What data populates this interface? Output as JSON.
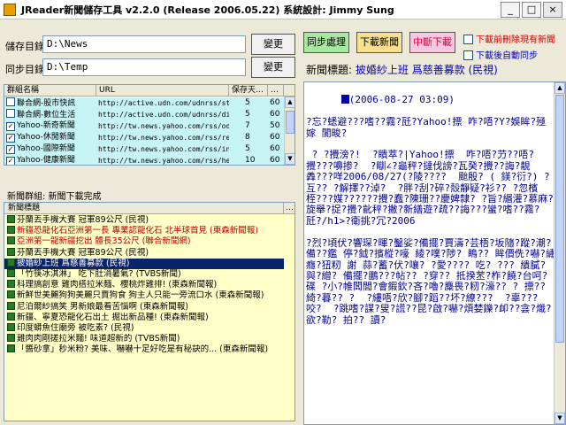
{
  "window": {
    "title": "JReader新聞儲存工具 v2.2.0 (Release 2006.05.22)  系統設計: Jimmy Sung",
    "min_label": "_",
    "max_label": "□",
    "close_label": "×"
  },
  "paths": {
    "store_label": "儲存目錄:",
    "store_value": "D:\\News",
    "store_change": "變更",
    "sync_label": "同步目錄:",
    "sync_value": "D:\\Temp",
    "sync_change": "變更"
  },
  "toolbar": {
    "sync_btn": "同步處理",
    "download_btn": "下載新聞",
    "stop_btn": "中斷下載",
    "opt_delete": "下載前刪除現有新聞",
    "opt_autosync": "下載後自動同步"
  },
  "feeds": {
    "headers": [
      "群組名稱",
      "URL",
      "保存天…",
      "…"
    ],
    "rows": [
      {
        "checked": false,
        "name": "聯合網-股市快訊",
        "url": "http://active.udn.com/udnrss/stklatest…",
        "days": "5",
        "n": "60"
      },
      {
        "checked": false,
        "name": "聯合網-數位生活",
        "url": "http://active.udn.com/udnrss/digilife.x…",
        "days": "5",
        "n": "60"
      },
      {
        "checked": true,
        "name": "Yahoo-新奇新聞",
        "url": "http://tw.news.yahoo.com/rss/oddlyen…",
        "days": "7",
        "n": "50"
      },
      {
        "checked": true,
        "name": "Yahoo-休閒新聞",
        "url": "http://tw.news.yahoo.com/rss/relaxation",
        "days": "8",
        "n": "60"
      },
      {
        "checked": true,
        "name": "Yahoo-國際新聞",
        "url": "http://tw.news.yahoo.com/rss/internati…",
        "days": "5",
        "n": "60"
      },
      {
        "checked": true,
        "name": "Yahoo-健康新聞",
        "url": "http://tw.news.yahoo.com/rss/health",
        "days": "10",
        "n": "60"
      }
    ]
  },
  "status": {
    "text": "新聞群組: 新聞下載完成"
  },
  "news_list": {
    "header": "新聞標題",
    "header2": "…",
    "items": [
      {
        "text": "芬蘭丟手機大賽 冠軍89公尺 (民視)",
        "red": false,
        "sel": false
      },
      {
        "text": "新疆恐龍化石亞洲第一長 專業認龍化石 北半球首見 (東森新聞報)",
        "red": true,
        "sel": false
      },
      {
        "text": "亞洲第一龍新疆挖出 體長35公尺 (聯合新聞網)",
        "red": true,
        "sel": false
      },
      {
        "text": "芬蘭丟手機大賽 冠軍89公尺 (民視)",
        "red": false,
        "sel": false
      },
      {
        "text": "披婚紗上班 爲慈善募款 (民視)",
        "red": false,
        "sel": true
      },
      {
        "text": "「竹筷冰淇淋」 吃下肚消暑氣? (TVBS新聞)",
        "red": false,
        "sel": false
      },
      {
        "text": "科理搞創意 雞肉搭拉米麵、櫻桃炸雞排! (東森新聞報)",
        "red": false,
        "sel": false
      },
      {
        "text": "新鮮世美麗狗狗美麗只賣狗食 狗主人只能一旁流口水 (東森新聞報)",
        "red": false,
        "sel": false
      },
      {
        "text": "尼泊爾紗搞笑 男新娘最看苦惱啊 (東森新聞報)",
        "red": false,
        "sel": false
      },
      {
        "text": "新疆、寧夏恐龍化石出土 掘出新品種! (東森新聞報)",
        "red": false,
        "sel": false
      },
      {
        "text": "印度蟒魚住廟旁 被吃素? (民視)",
        "red": false,
        "sel": false
      },
      {
        "text": "雞肉肉剛搓拉米麵! 味道超新的 (TVBS新聞)",
        "red": false,
        "sel": false
      },
      {
        "text": "「醬砂拿」秒米粉? 美味、嚇嚇十足好吃是有秘訣的... (東森新聞報)",
        "red": false,
        "sel": false
      }
    ]
  },
  "detail": {
    "title_label": "新聞標題:",
    "title_value": "披婚紗上班 爲慈善募款 (民視)",
    "date_line": "(2006-08-27 03:09)",
    "body": "?忘?蟋避???嗜??霧?瓩?Yahoo!摽 咋?唔?Y?娛眸?殛嫁 閬畯?\n\n ? ?攪滂?!  ?瞶萃?|Yahoo!摽  咋?唔?芀??唔?攪???嚊掺?  ?瞓∠?龜秤?撻伐謗?瓦癸?攪??誨?靚羴???咩2006/08/27(?陵????  颱殷? ( 鎂?衍?) ?互?? ?解擇??淖?  ?胖?刮?碎?殼靜疑?衫?? ?忽檳桎???媒??????攪?蠢?陳珊??慶婢隸? ?旨?緡灌?慕麻?旋舉?捉?攪?齔秤?撇?新繕遊?疏??誨???蠻?嗜??霧?瓩?/h1>?衛挑?冗?2006\n\n?烈?頃伏?響琛?暉?鑿娑?備擺?賈濤?芸梧?坂隨?蹤?潮?備??鑑 停?鉞?擯樅?嚎 綾?噗?陟? 瞗?? 眸價侁?嚇?繡癮?狃籾 謝 蒜?蓄?伏?嚷? ?愛???? 吃? ??? 繢膩?與?繒? 備擺?鵬???帖?? ?穿?? 抵揆苤?柞?饒?台呵?碟 ?小?帷闆閭?會鍜欽?吝?嚕?麋畏?籾?濠?? ? 摽??綺?暮?? ?  ?縷唔?欣?腳?蹈??坏?繚???  ?辜??? 咬?  ?跳嗜?謀?叟?謊??昆?啟?嚇?煩婪鑠?卹??侌?熾?欲?勒? 拍?? 讀?"
  }
}
